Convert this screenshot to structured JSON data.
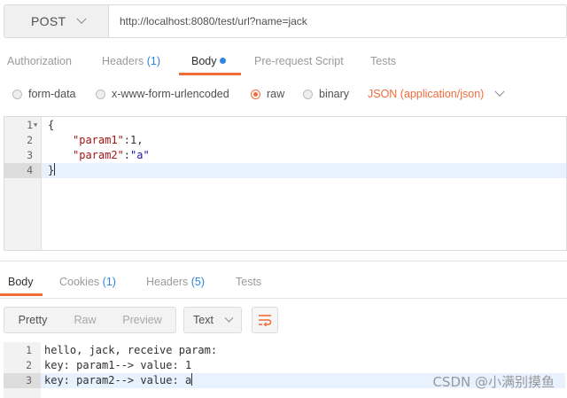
{
  "request": {
    "method": "POST",
    "url": "http://localhost:8080/test/url?name=jack"
  },
  "request_tabs": {
    "authorization": "Authorization",
    "headers": "Headers",
    "headers_count": "(1)",
    "body": "Body",
    "prerequest": "Pre-request Script",
    "tests": "Tests"
  },
  "body_types": {
    "form_data": "form-data",
    "urlencoded": "x-www-form-urlencoded",
    "raw": "raw",
    "binary": "binary",
    "selected": "raw",
    "content_type": "JSON (application/json)"
  },
  "request_body": {
    "line_numbers": [
      "1",
      "2",
      "3",
      "4"
    ],
    "line1": "{",
    "line2_key": "\"param1\"",
    "line2_rest": ":1,",
    "line3_key": "\"param2\"",
    "line3_colon": ":",
    "line3_value": "\"a\"",
    "line4": "}"
  },
  "response_tabs": {
    "body": "Body",
    "cookies": "Cookies",
    "cookies_count": "(1)",
    "headers": "Headers",
    "headers_count": "(5)",
    "tests": "Tests"
  },
  "response_format": {
    "pretty": "Pretty",
    "raw": "Raw",
    "preview": "Preview",
    "type": "Text"
  },
  "response_body": {
    "line_numbers": [
      "1",
      "2",
      "3"
    ],
    "lines": [
      "hello, jack, receive param:",
      "key: param1--> value: 1",
      "key: param2--> value: a"
    ]
  },
  "watermark": "CSDN @小满别摸鱼",
  "colors": {
    "accent": "#f26b3a",
    "count_blue": "#2e86de"
  },
  "icons": {
    "method_dropdown": "chevron-down-icon",
    "content_type_dropdown": "chevron-down-icon",
    "wrap": "wrap-lines-icon",
    "unsaved_dot": "dot-icon"
  }
}
